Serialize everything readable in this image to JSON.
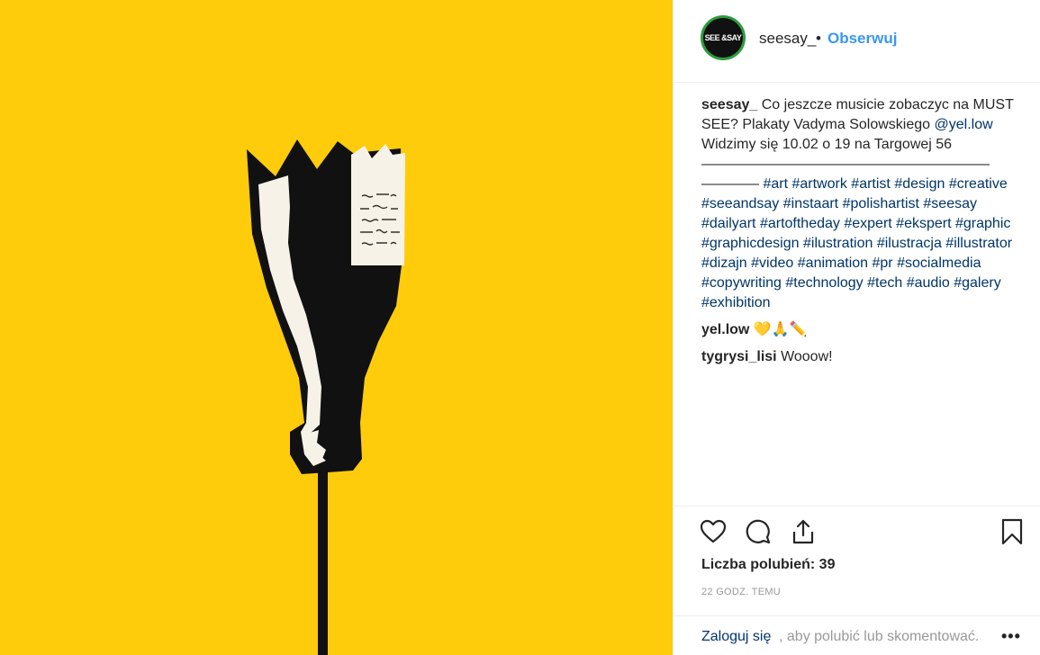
{
  "header": {
    "avatar_text": "SEE &SAY",
    "username": "seesay_",
    "separator": "•",
    "follow_label": "Obserwuj"
  },
  "caption": {
    "username": "seesay_",
    "line1": "Co jeszcze musicie zobaczyc na MUST",
    "line2": "SEE? Plakaty Vadyma Solowskiego",
    "mention": "@yel.low",
    "line3": "Widzimy się 10.02 o 19 na Targowej 56",
    "divider1": "————————————————————",
    "divider2": "————",
    "hashtags": [
      "#art",
      "#artwork",
      "#artist",
      "#design",
      "#creative",
      "#seeandsay",
      "#instaart",
      "#polishartist",
      "#seesay",
      "#dailyart",
      "#artoftheday",
      "#expert",
      "#ekspert",
      "#graphic",
      "#graphicdesign",
      "#ilustration",
      "#ilustracja",
      "#illustrator",
      "#dizajn",
      "#video",
      "#animation",
      "#pr",
      "#socialmedia",
      "#copywriting",
      "#technology",
      "#tech",
      "#audio",
      "#galery",
      "#exhibition"
    ]
  },
  "comments": [
    {
      "username": "yel.low",
      "text": "💛🙏✏️"
    },
    {
      "username": "tygrysi_lisi",
      "text": "Wooow!"
    }
  ],
  "actions": {
    "icons": [
      "heart-icon",
      "comment-icon",
      "share-icon",
      "bookmark-icon"
    ],
    "likes_label": "Liczba polubień: 39",
    "timestamp": "22 GODZ. TEMU"
  },
  "footer": {
    "login_label": "Zaloguj się",
    "login_rest": ", aby polubić lub skomentować.",
    "more_label": "•••"
  },
  "colors": {
    "image_background": "#ffcc0b",
    "link_blue": "#3897f0",
    "hashtag_blue": "#003569",
    "avatar_ring": "#2e9c3e"
  }
}
